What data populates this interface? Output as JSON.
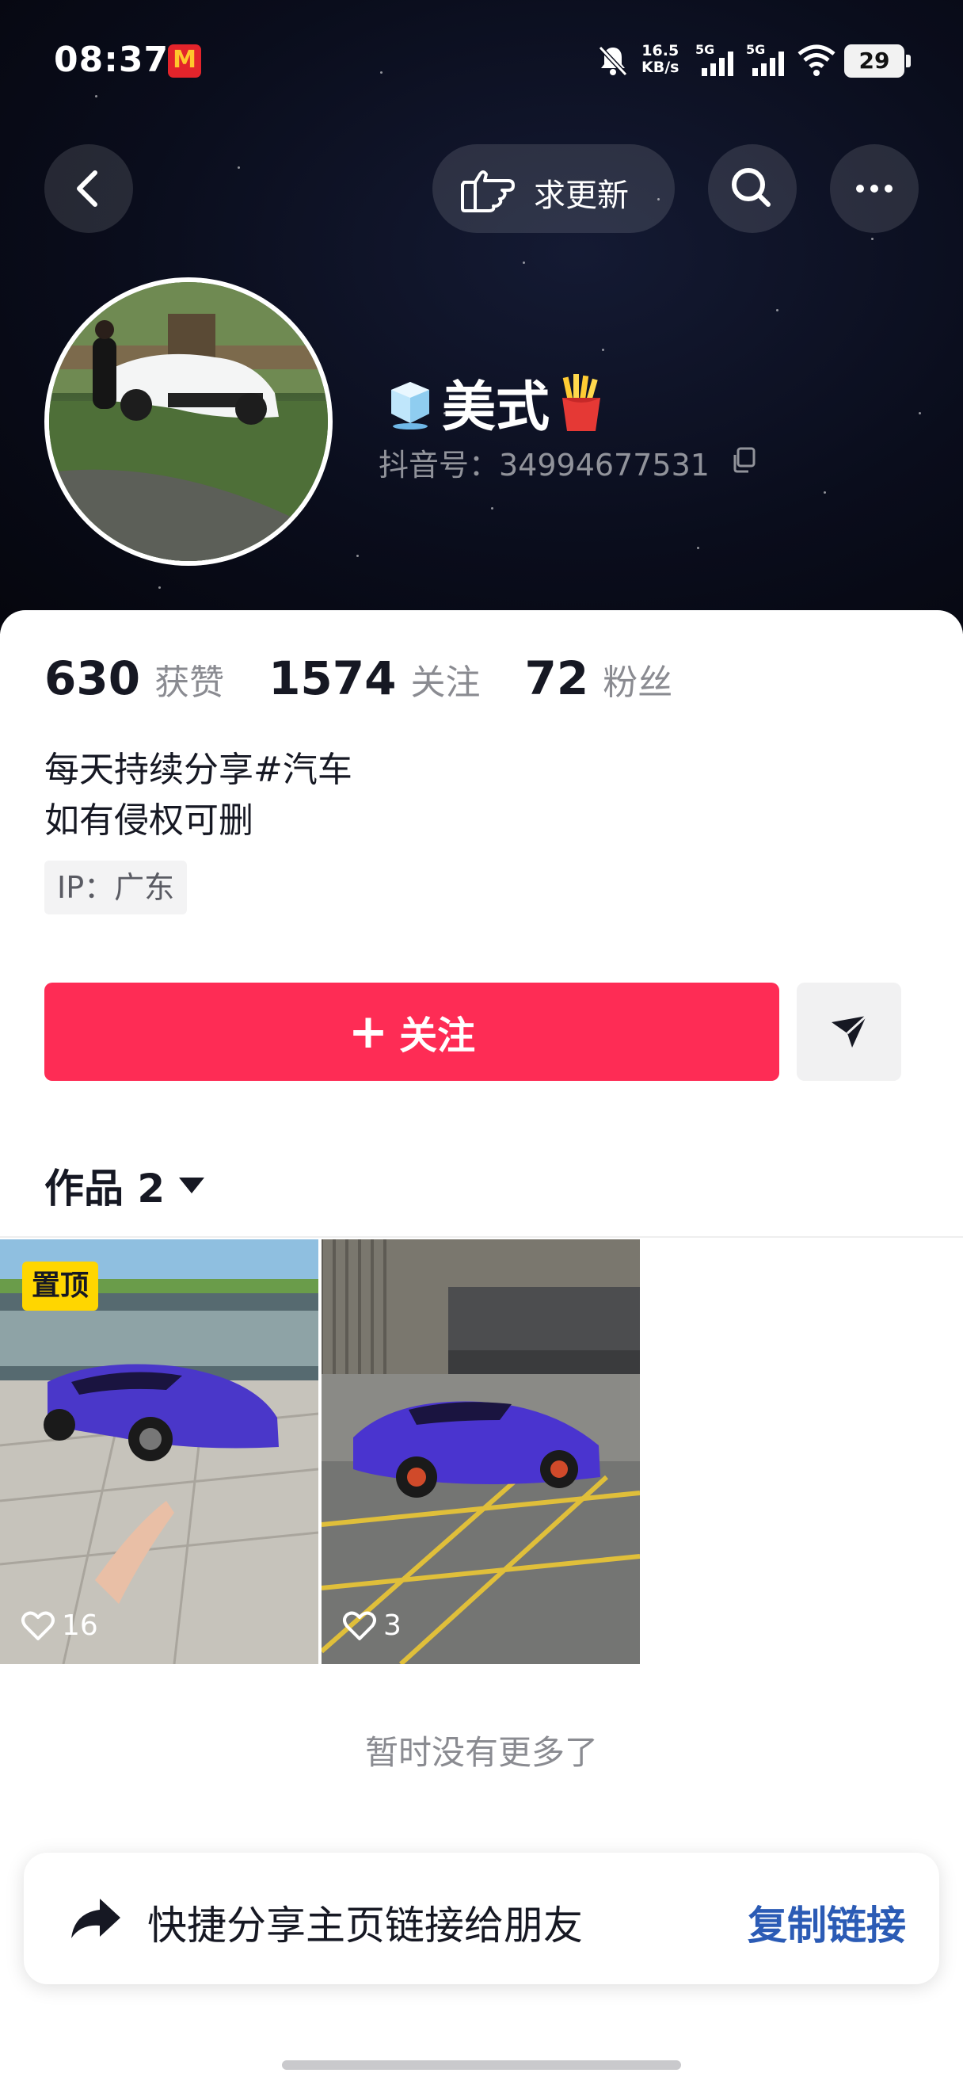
{
  "status_bar": {
    "time": "08:37",
    "net_speed_value": "16.5",
    "net_speed_unit": "KB/s",
    "sim1": "5G",
    "sim2": "5G",
    "battery": "29"
  },
  "nav": {
    "request_update_label": "求更新"
  },
  "profile": {
    "display_name": "美式",
    "id_label": "抖音号：34994677531"
  },
  "stats": [
    {
      "value": "630",
      "label": "获赞"
    },
    {
      "value": "1574",
      "label": "关注"
    },
    {
      "value": "72",
      "label": "粉丝"
    }
  ],
  "bio": {
    "line1": "每天持续分享#汽车",
    "line2": "如有侵权可删",
    "ip": "IP：广东"
  },
  "actions": {
    "follow_label": "关注"
  },
  "works": {
    "tab_label": "作品 2",
    "items": [
      {
        "pinned_label": "置顶",
        "likes": "16"
      },
      {
        "likes": "3"
      }
    ],
    "end_text": "暂时没有更多了"
  },
  "share": {
    "text": "快捷分享主页链接给朋友",
    "copy_label": "复制链接"
  },
  "colors": {
    "follow_button": "#fe2c55",
    "link": "#2b5bb5",
    "pin_badge": "#ffd600"
  }
}
